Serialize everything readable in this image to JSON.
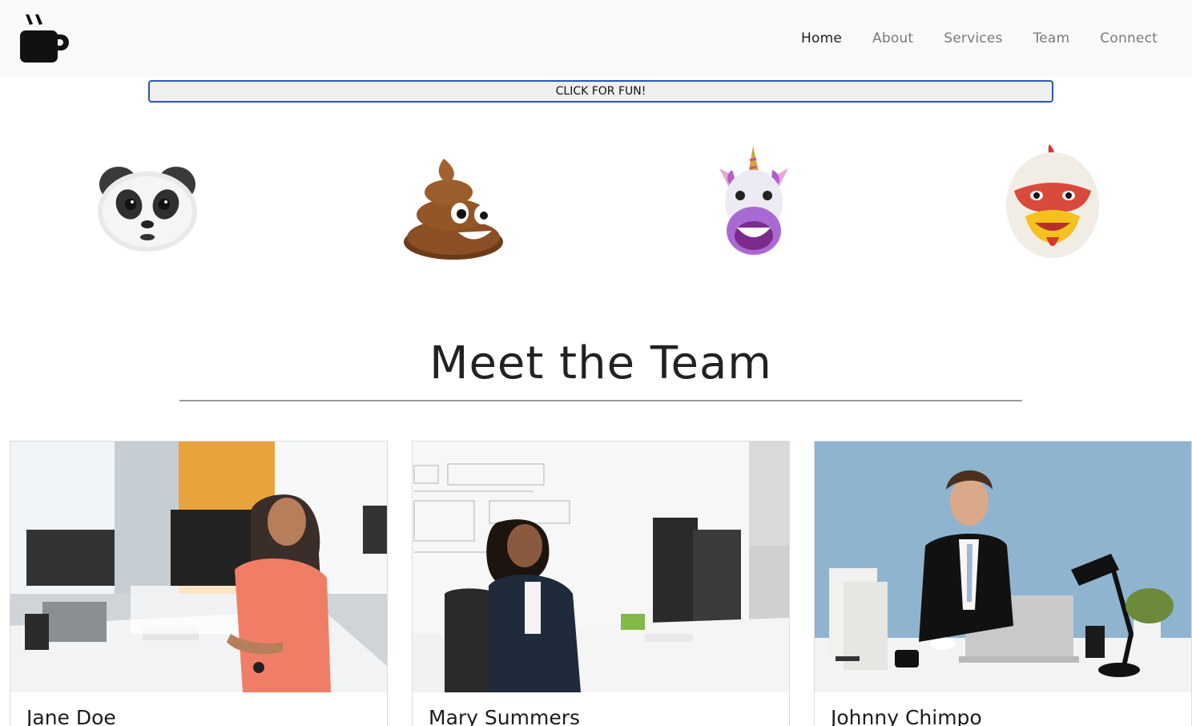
{
  "navbar": {
    "logo_icon": "coffee-mug-icon",
    "links": [
      {
        "label": "Home",
        "active": true
      },
      {
        "label": "About",
        "active": false
      },
      {
        "label": "Services",
        "active": false
      },
      {
        "label": "Team",
        "active": false
      },
      {
        "label": "Connect",
        "active": false
      }
    ]
  },
  "fun_button": {
    "label": "CLICK FOR FUN!"
  },
  "animoji": [
    "panda-icon",
    "poop-icon",
    "unicorn-icon",
    "chicken-icon"
  ],
  "team_section": {
    "title": "Meet the Team",
    "members": [
      {
        "name": "Jane Doe"
      },
      {
        "name": "Mary Summers"
      },
      {
        "name": "Johnny Chimpo"
      }
    ]
  },
  "colors": {
    "navbar_bg": "#f8f9fa",
    "button_border": "#2a55b8",
    "wall_blue": "#8fb4d0"
  }
}
